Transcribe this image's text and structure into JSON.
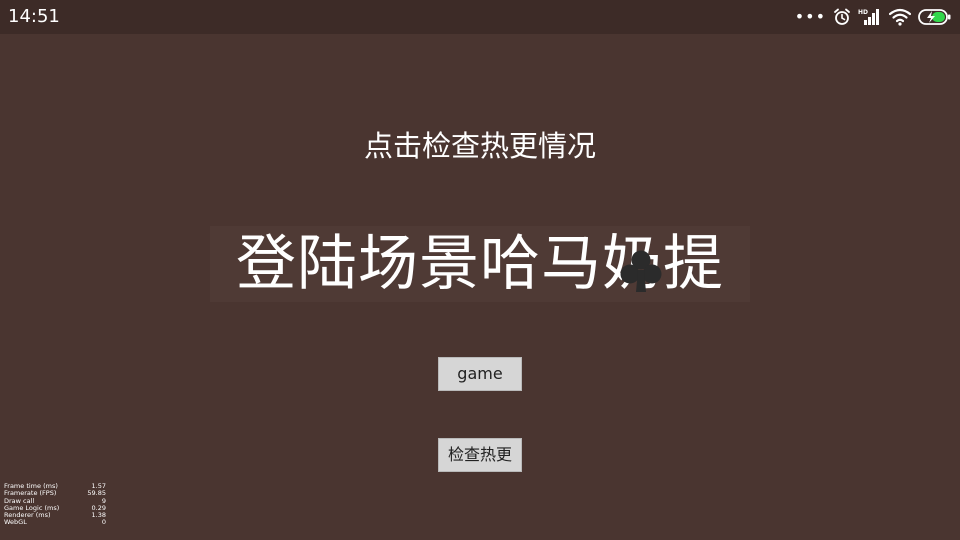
{
  "status_bar": {
    "time": "14:51",
    "more_dots": "•••",
    "icons": [
      "more-dots-icon",
      "alarm-icon",
      "hd-signal-icon",
      "wifi-icon",
      "battery-charging-icon"
    ]
  },
  "main": {
    "hot_update_status": "点击检查热更情况",
    "scene_title": "登陆场景哈马奶提",
    "game_button": "game",
    "check_update_button": "检查热更"
  },
  "stats": [
    {
      "label": "Frame time (ms)",
      "value": "1.57"
    },
    {
      "label": "Framerate (FPS)",
      "value": "59.85"
    },
    {
      "label": "Draw call",
      "value": "9"
    },
    {
      "label": "Game Logic (ms)",
      "value": "0.29"
    },
    {
      "label": "Renderer (ms)",
      "value": "1.38"
    },
    {
      "label": "WebGL",
      "value": "0"
    }
  ],
  "colors": {
    "background": "#4a3530",
    "status_bar": "#3d2b27",
    "button": "#d6d6d6",
    "battery_fill": "#32d74b"
  }
}
